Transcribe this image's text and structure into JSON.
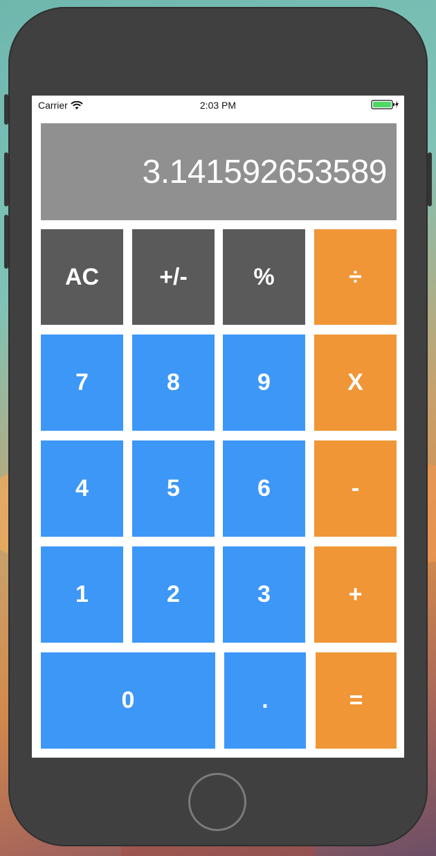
{
  "status_bar": {
    "carrier": "Carrier",
    "time": "2:03 PM",
    "wifi_icon": "wifi-icon",
    "battery_icon": "battery-charging-icon",
    "battery_color": "#4cd964"
  },
  "display": {
    "value": "3.141592653589",
    "background": "#909090"
  },
  "keys": {
    "ac": "AC",
    "plus_minus": "+/-",
    "percent": "%",
    "divide": "÷",
    "seven": "7",
    "eight": "8",
    "nine": "9",
    "multiply": "X",
    "four": "4",
    "five": "5",
    "six": "6",
    "minus": "-",
    "one": "1",
    "two": "2",
    "three": "3",
    "plus": "+",
    "zero": "0",
    "decimal": ".",
    "equals": "="
  },
  "colors": {
    "function_key": "#5a5a5a",
    "number_key": "#3d97f7",
    "operator_key": "#f09636",
    "device_body": "#404040"
  }
}
